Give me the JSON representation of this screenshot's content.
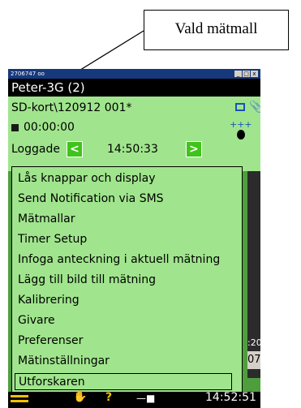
{
  "annotation": {
    "callout_text": "Vald mätmall"
  },
  "window": {
    "title": "2706747 oo",
    "btn_min": "_",
    "btn_max": "□",
    "btn_close": "x"
  },
  "header": {
    "template_name": "Peter-3G (2)"
  },
  "status": {
    "storage_path": "SD-kort\\120912 001*",
    "elapsed": "00:00:00",
    "log_label": "Loggade",
    "log_time": "14:50:33",
    "prev_glyph": "<",
    "next_glyph": ">"
  },
  "menu": {
    "items": [
      {
        "label": "Lås knappar och display"
      },
      {
        "label": "Send Notification via SMS"
      },
      {
        "label": "Mätmallar"
      },
      {
        "label": "Timer Setup"
      },
      {
        "label": "Infoga anteckning i aktuell mätning"
      },
      {
        "label": "Lägg till bild till mätning"
      },
      {
        "label": "Kalibrering"
      },
      {
        "label": "Givare"
      },
      {
        "label": "Preferenser"
      },
      {
        "label": "Mätinställningar"
      },
      {
        "label": "Utforskaren"
      }
    ],
    "selected_index": 10
  },
  "background_fragments": {
    "side_time": ":20",
    "side_value": "07",
    "dash": "- -"
  },
  "toolbar": {
    "clock": "14:52:51"
  },
  "icons": {
    "network": "network-icon",
    "paperclip": "paperclip-icon",
    "microphone": "microphone-icon",
    "menu": "hamburger-menu-icon",
    "hand": "hand-icon",
    "help": "help-icon",
    "plug": "power-plug-icon"
  },
  "colors": {
    "screen_bg": "#a0e58d",
    "header_bg": "#000000",
    "nav_button": "#3ec41a",
    "titlebar": "#16387c",
    "toolbar_accent": "#f0c000"
  }
}
